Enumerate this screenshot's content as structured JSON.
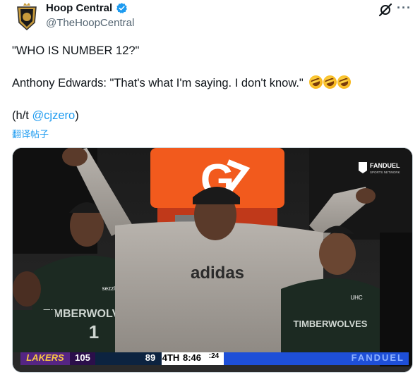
{
  "author": {
    "name": "Hoop Central",
    "handle": "@TheHoopCentral",
    "icons": [
      "avatar-logo",
      "verified-badge-icon",
      "grok-icon",
      "more-options-icon"
    ]
  },
  "tweet": {
    "line1": "\"WHO IS NUMBER 12?\"",
    "line2": "Anthony Edwards: \"That's what I'm saying. I don't know.\"",
    "line2_emoji": "🤣🤣🤣",
    "line3_prefix": "(h/t ",
    "line3_mention": "@cjzero",
    "line3_suffix": ")",
    "translate_label": "翻译帖子"
  },
  "media": {
    "watermark_brand": "FANDUEL",
    "watermark_sub": "SPORTS NETWORK",
    "cooler_letter": "G",
    "hoodie_text": "adidas",
    "jersey_text": "TIMBERWOLVES",
    "jersey_number": "1",
    "sponsor": "sezzle",
    "sponsor_right": "UHC",
    "scoreboard": {
      "team1": "LAKERS",
      "team1_score": "105",
      "team2_score": "89",
      "quarter": "4TH",
      "clock": "8:46",
      "shot_clock": ":24",
      "banner": "FANDUEL"
    }
  },
  "colors": {
    "link": "#1d9bf0",
    "text": "#0f1419",
    "secondary": "#536471",
    "lakers_purple": "#552583",
    "gatorade_orange": "#f25a1d",
    "banner_blue": "#1e4fd8"
  }
}
